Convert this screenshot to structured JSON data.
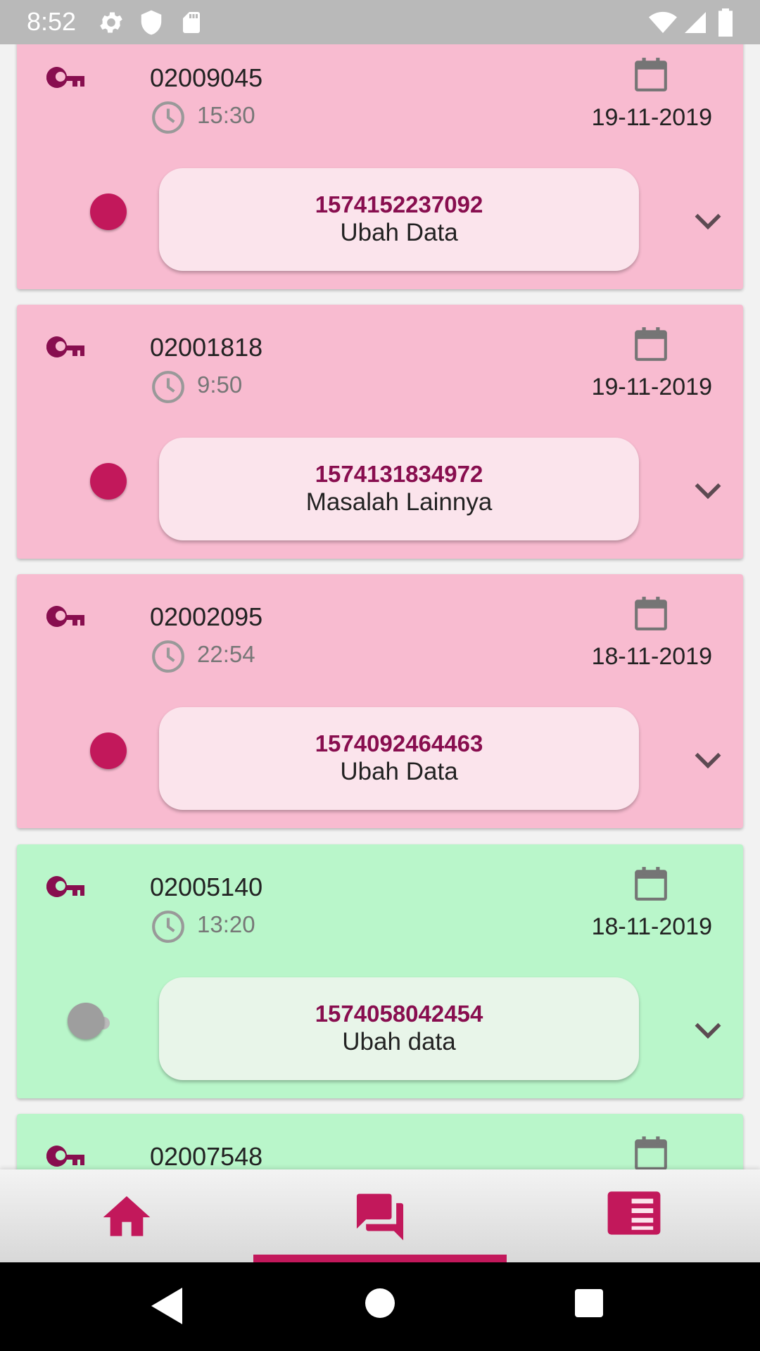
{
  "status_bar": {
    "time": "8:52",
    "left_icons": [
      "gear-icon",
      "shield-icon",
      "sd-card-icon"
    ],
    "right_icons": [
      "wifi-icon",
      "signal-icon",
      "battery-icon"
    ]
  },
  "tickets": [
    {
      "id": "02009045",
      "time": "15:30",
      "date": "19-11-2019",
      "number": "1574152237092",
      "subject": "Ubah Data",
      "status": "pending",
      "toggle_on": true
    },
    {
      "id": "02001818",
      "time": "9:50",
      "date": "19-11-2019",
      "number": "1574131834972",
      "subject": "Masalah Lainnya",
      "status": "pending",
      "toggle_on": true
    },
    {
      "id": "02002095",
      "time": "22:54",
      "date": "18-11-2019",
      "number": "1574092464463",
      "subject": "Ubah Data",
      "status": "pending",
      "toggle_on": true
    },
    {
      "id": "02005140",
      "time": "13:20",
      "date": "18-11-2019",
      "number": "1574058042454",
      "subject": "Ubah data",
      "status": "done",
      "toggle_on": false
    },
    {
      "id": "02007548",
      "status": "done"
    }
  ],
  "bottom_nav": {
    "items": [
      {
        "icon": "home-icon",
        "active": false
      },
      {
        "icon": "chat-icon",
        "active": true
      },
      {
        "icon": "news-icon",
        "active": false
      }
    ]
  },
  "colors": {
    "accent": "#c2185b",
    "pending_card": "#f8bbd0",
    "done_card": "#b9f6ca",
    "ticket_number": "#880e4f"
  }
}
